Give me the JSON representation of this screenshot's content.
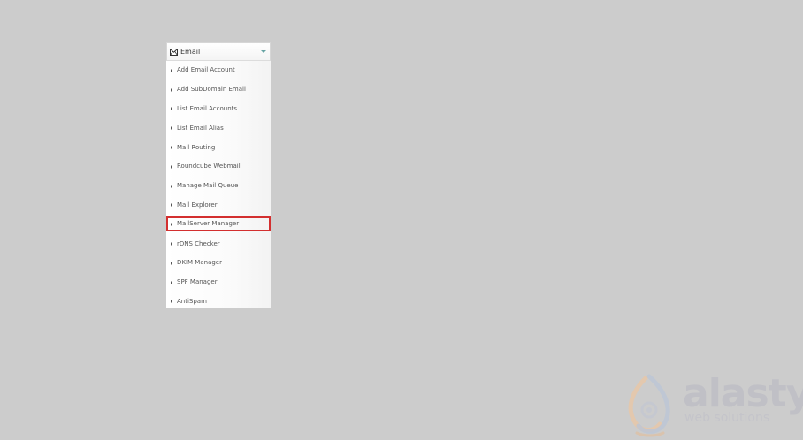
{
  "panel": {
    "title": "Email",
    "icon": "mail-icon",
    "caret_icon": "caret-down-icon",
    "items": [
      {
        "label": "Add Email Account"
      },
      {
        "label": "Add SubDomain Email"
      },
      {
        "label": "List Email Accounts"
      },
      {
        "label": "List Email Alias"
      },
      {
        "label": "Mail Routing"
      },
      {
        "label": "Roundcube Webmail"
      },
      {
        "label": "Manage Mail Queue"
      },
      {
        "label": "Mail Explorer"
      },
      {
        "label": "MailServer Manager",
        "highlighted": true
      },
      {
        "label": "rDNS Checker"
      },
      {
        "label": "DKIM Manager"
      },
      {
        "label": "SPF Manager"
      },
      {
        "label": "AntiSpam"
      }
    ]
  },
  "watermark": {
    "brand": "alastyr",
    "tagline": "web solutions"
  },
  "colors": {
    "background": "#cccccc",
    "highlight_border": "#d32f2f",
    "caret": "#66a3a3",
    "text": "#555555"
  }
}
